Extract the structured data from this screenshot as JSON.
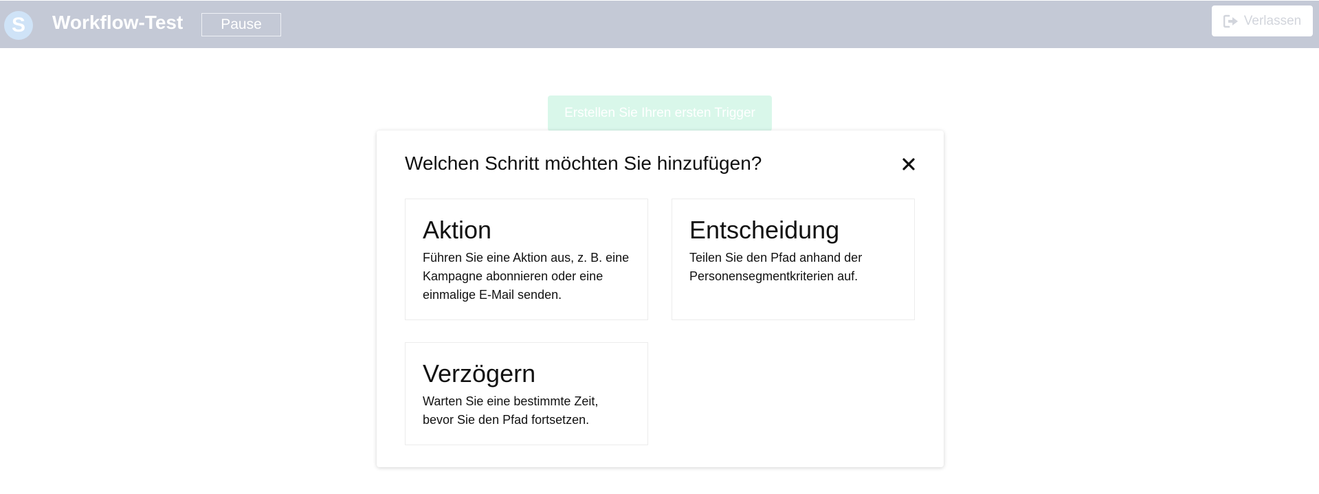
{
  "header": {
    "logo_letter": "S",
    "title": "Workflow-Test",
    "pause_label": "Pause",
    "leave_label": "Verlassen"
  },
  "canvas": {
    "trigger_label": "Erstellen Sie Ihren ersten Trigger"
  },
  "modal": {
    "title": "Welchen Schritt möchten Sie hinzufügen?",
    "close_icon": "close-icon",
    "options": [
      {
        "title": "Aktion",
        "description": "Führen Sie eine Aktion aus, z. B. eine Kampagne abonnieren oder eine einmalige E-Mail senden."
      },
      {
        "title": "Entscheidung",
        "description": "Teilen Sie den Pfad anhand der Personensegmentkriterien auf."
      },
      {
        "title": "Verzögern",
        "description": "Warten Sie eine bestimmte Zeit, bevor Sie den Pfad fortsetzen."
      }
    ]
  },
  "colors": {
    "header_bg": "#c4c9d6",
    "logo_bg": "#cfe3f7",
    "trigger_bg": "#d9f7ea",
    "leave_text": "#d2d5dc"
  }
}
